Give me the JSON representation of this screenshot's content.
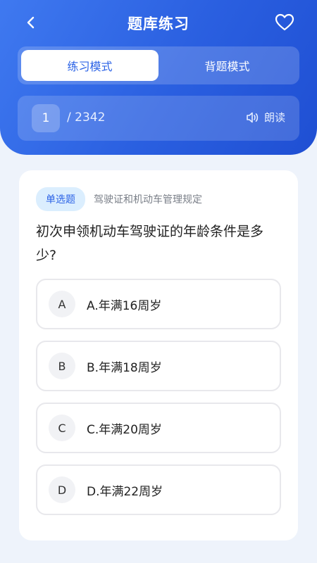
{
  "header": {
    "title": "题库练习",
    "icons": {
      "back": "chevron-left-icon",
      "favorite": "heart-icon"
    }
  },
  "modes": [
    {
      "label": "练习模式",
      "active": true
    },
    {
      "label": "背题模式",
      "active": false
    }
  ],
  "progress": {
    "current": "1",
    "total": "/ 2342",
    "read_label": "朗读",
    "read_icon": "speaker-icon"
  },
  "question": {
    "type": "单选题",
    "category": "驾驶证和机动车管理规定",
    "text": "初次申领机动车驾驶证的年龄条件是多少?",
    "options": [
      {
        "letter": "A",
        "text": "A.年满16周岁"
      },
      {
        "letter": "B",
        "text": "B.年满18周岁"
      },
      {
        "letter": "C",
        "text": "C.年满20周岁"
      },
      {
        "letter": "D",
        "text": "D.年满22周岁"
      }
    ]
  },
  "colors": {
    "accent": "#2c63e6",
    "header_gradient_start": "#3f79f0",
    "header_gradient_end": "#1f4fd3",
    "background": "#eef3fb"
  }
}
